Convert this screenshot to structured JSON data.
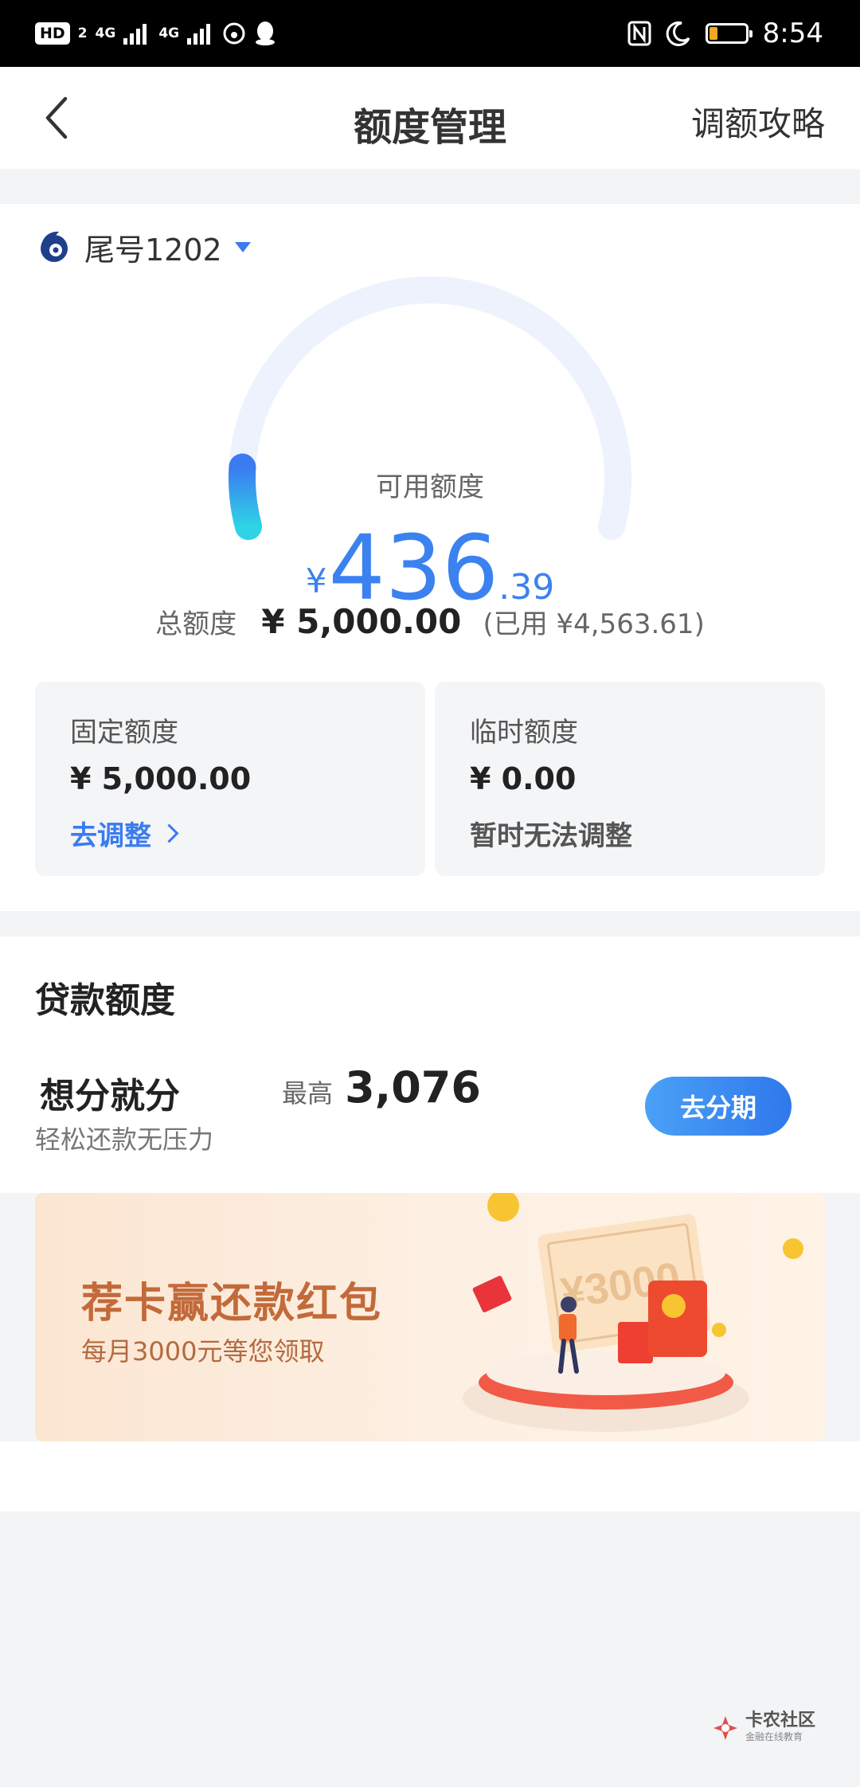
{
  "status_bar": {
    "hd_badge": "HD",
    "sim_index": "2",
    "network1": "4G",
    "network2": "4G",
    "time": "8:54",
    "battery_level": 0.22
  },
  "header": {
    "title": "额度管理",
    "right_link": "调额攻略"
  },
  "account": {
    "label": "尾号1202"
  },
  "credit": {
    "available_label": "可用额度",
    "available_currency": "¥",
    "available_integer": "436",
    "available_decimal": ".39",
    "available_fraction_of_total": 0.087,
    "total_label": "总额度",
    "total_value": "¥ 5,000.00",
    "used_text": "(已用 ¥4,563.61)"
  },
  "fixed_limit": {
    "title": "固定额度",
    "value": "¥ 5,000.00",
    "action": "去调整"
  },
  "temp_limit": {
    "title": "临时额度",
    "value": "¥ 0.00",
    "note": "暂时无法调整"
  },
  "loan": {
    "section_title": "贷款额度",
    "product_name": "想分就分",
    "product_desc": "轻松还款无压力",
    "max_label": "最高",
    "max_value": "3,076",
    "button": "去分期"
  },
  "banner": {
    "title": "荐卡赢还款红包",
    "subtitle": "每月3000元等您领取",
    "art_text": "¥3000"
  },
  "watermark": {
    "name": "卡农社区",
    "tagline": "金融在线教育"
  },
  "colors": {
    "accent": "#3b82f0",
    "gauge_track": "#eef2fd",
    "banner_text": "#c26a3a"
  }
}
